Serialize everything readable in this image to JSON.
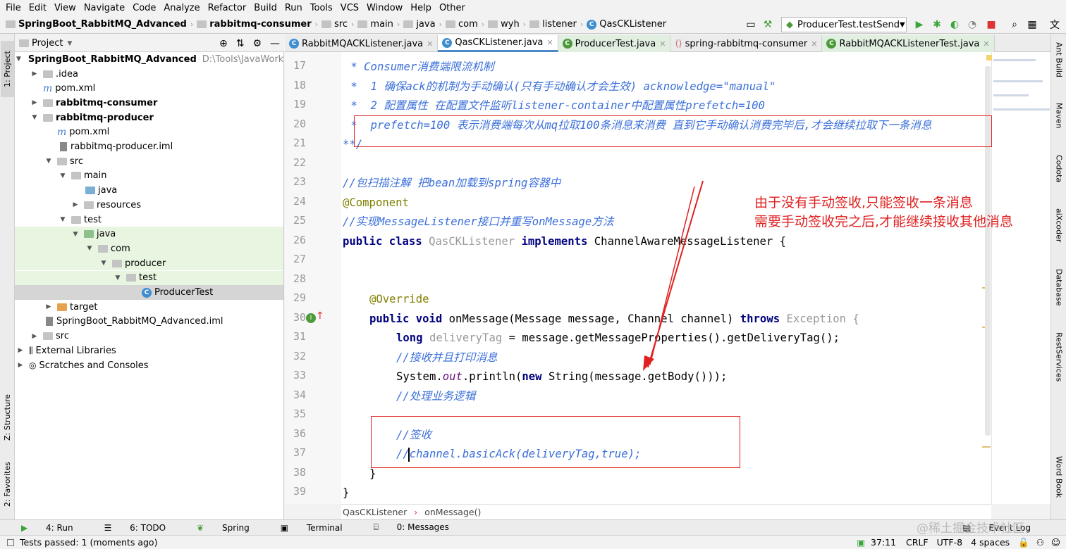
{
  "menu": [
    "File",
    "Edit",
    "View",
    "Navigate",
    "Code",
    "Analyze",
    "Refactor",
    "Build",
    "Run",
    "Tools",
    "VCS",
    "Window",
    "Help",
    "Other"
  ],
  "nav": {
    "crumbs": [
      "SpringBoot_RabbitMQ_Advanced",
      "rabbitmq-consumer",
      "src",
      "main",
      "java",
      "com",
      "wyh",
      "listener",
      "QasCKListener"
    ],
    "run_config": "ProducerTest.testSend"
  },
  "project_panel": {
    "title": "Project",
    "tree": [
      {
        "label": "SpringBoot_RabbitMQ_Advanced",
        "extra": "D:\\Tools\\JavaWorkSpace",
        "bold": true
      },
      {
        "label": ".idea"
      },
      {
        "label": "pom.xml"
      },
      {
        "label": "rabbitmq-consumer",
        "bold": true
      },
      {
        "label": "rabbitmq-producer",
        "bold": true
      },
      {
        "label": "pom.xml"
      },
      {
        "label": "rabbitmq-producer.iml"
      },
      {
        "label": "src"
      },
      {
        "label": "main"
      },
      {
        "label": "java"
      },
      {
        "label": "resources"
      },
      {
        "label": "test"
      },
      {
        "label": "java"
      },
      {
        "label": "com"
      },
      {
        "label": "producer"
      },
      {
        "label": "test"
      },
      {
        "label": "ProducerTest"
      },
      {
        "label": "target"
      },
      {
        "label": "SpringBoot_RabbitMQ_Advanced.iml"
      },
      {
        "label": "src"
      },
      {
        "label": "External Libraries"
      },
      {
        "label": "Scratches and Consoles"
      }
    ]
  },
  "tabs": [
    "RabbitMQACKListener.java",
    "QasCKListener.java",
    "ProducerTest.java",
    "spring-rabbitmq-consumer",
    "RabbitMQACKListenerTest.java"
  ],
  "line_numbers": [
    "17",
    "18",
    "19",
    "20",
    "21",
    "22",
    "23",
    "24",
    "25",
    "26",
    "27",
    "28",
    "29",
    "30",
    "31",
    "32",
    "33",
    "34",
    "35",
    "36",
    "37",
    "38",
    "39"
  ],
  "code": {
    "l17": " * Consumer消费端限流机制",
    "l18": " *  1 确保ack的机制为手动确认(只有手动确认才会生效) acknowledge=\"manual\"",
    "l19": " *  2 配置属性 在配置文件监听listener-container中配置属性prefetch=100",
    "l20": " *  prefetch=100 表示消费端每次从mq拉取100条消息来消费 直到它手动确认消费完毕后,才会继续拉取下一条消息",
    "l21": "**/",
    "l23": "//包扫描注解 把bean加载到spring容器中",
    "l24": "@Component",
    "l25": "//实现MessageListener接口并重写onMessage方法",
    "l26_kw": "public class ",
    "l26_name": "QasCKListener",
    "l26_impl": " implements ",
    "l26_rest": "ChannelAwareMessageListener {",
    "l29": "@Override",
    "l30_kw": "public void ",
    "l30_rest": "onMessage(Message message, Channel channel) ",
    "l30_throws": "throws ",
    "l30_exc": "Exception {",
    "l31_kw": "long ",
    "l31_var": "deliveryTag",
    "l31_rest": " = message.getMessageProperties().getDeliveryTag();",
    "l32": "//接收并且打印消息",
    "l33_a": "System.",
    "l33_out": "out",
    "l33_b": ".println(",
    "l33_new": "new ",
    "l33_c": "String(message.getBody()));",
    "l34": "//处理业务逻辑",
    "l36": "//签收",
    "l37": "//channel.basicAck(deliveryTag,true);",
    "l38": "}",
    "l39": "}"
  },
  "annotation_note": [
    "由于没有手动签收,只能签收一条消息",
    "需要手动签收完之后,才能继续接收其他消息"
  ],
  "editor_breadcrumb": [
    "QasCKListener",
    "onMessage()"
  ],
  "bottom_tools": [
    "4: Run",
    "6: TODO",
    "Spring",
    "Terminal",
    "0: Messages",
    "Event Log"
  ],
  "left_tools": [
    "1: Project",
    "Z: Structure",
    "2: Favorites"
  ],
  "right_tools": [
    "Ant Build",
    "Maven",
    "Codota",
    "aiXcoder",
    "Database",
    "RestServices",
    "Word Book"
  ],
  "status": {
    "tests": "Tests passed: 1 (moments ago)",
    "position": "37:11",
    "line_sep": "CRLF",
    "encoding": "UTF-8",
    "indent": "4 spaces"
  },
  "watermark": "@稀土掘金技术社区",
  "colors": {
    "annotation_red": "#e02020",
    "comment_blue": "#3b6fd9",
    "keyword_navy": "#000080"
  }
}
